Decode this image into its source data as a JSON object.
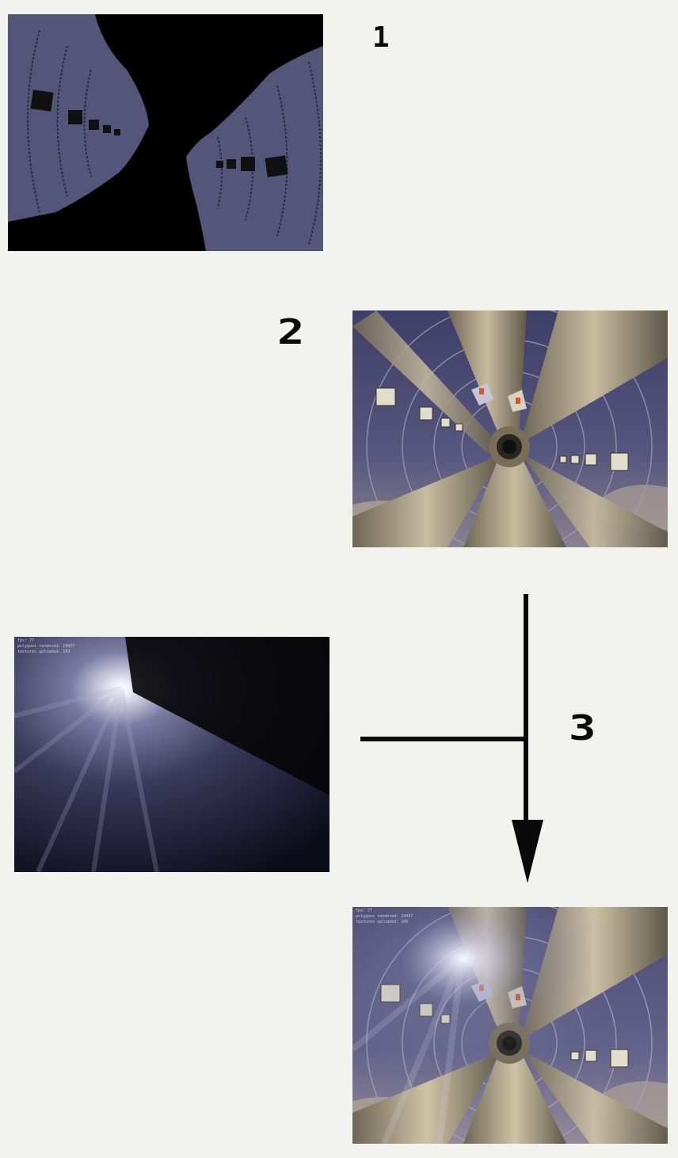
{
  "steps": {
    "one": "1",
    "two": "2",
    "three": "3"
  },
  "panels": [
    {
      "id": "silhouette",
      "description_name": "tunnel-silhouette-pass"
    },
    {
      "id": "textured",
      "description_name": "tunnel-textured-render"
    },
    {
      "id": "light-shafts",
      "description_name": "light-shafts-pass"
    },
    {
      "id": "composite",
      "description_name": "final-composite"
    }
  ],
  "colors": {
    "background": "#f2f2ee",
    "tunnel_purple": "#55557a",
    "stone": "#b3a78e",
    "ink": "#0a0a0a"
  }
}
